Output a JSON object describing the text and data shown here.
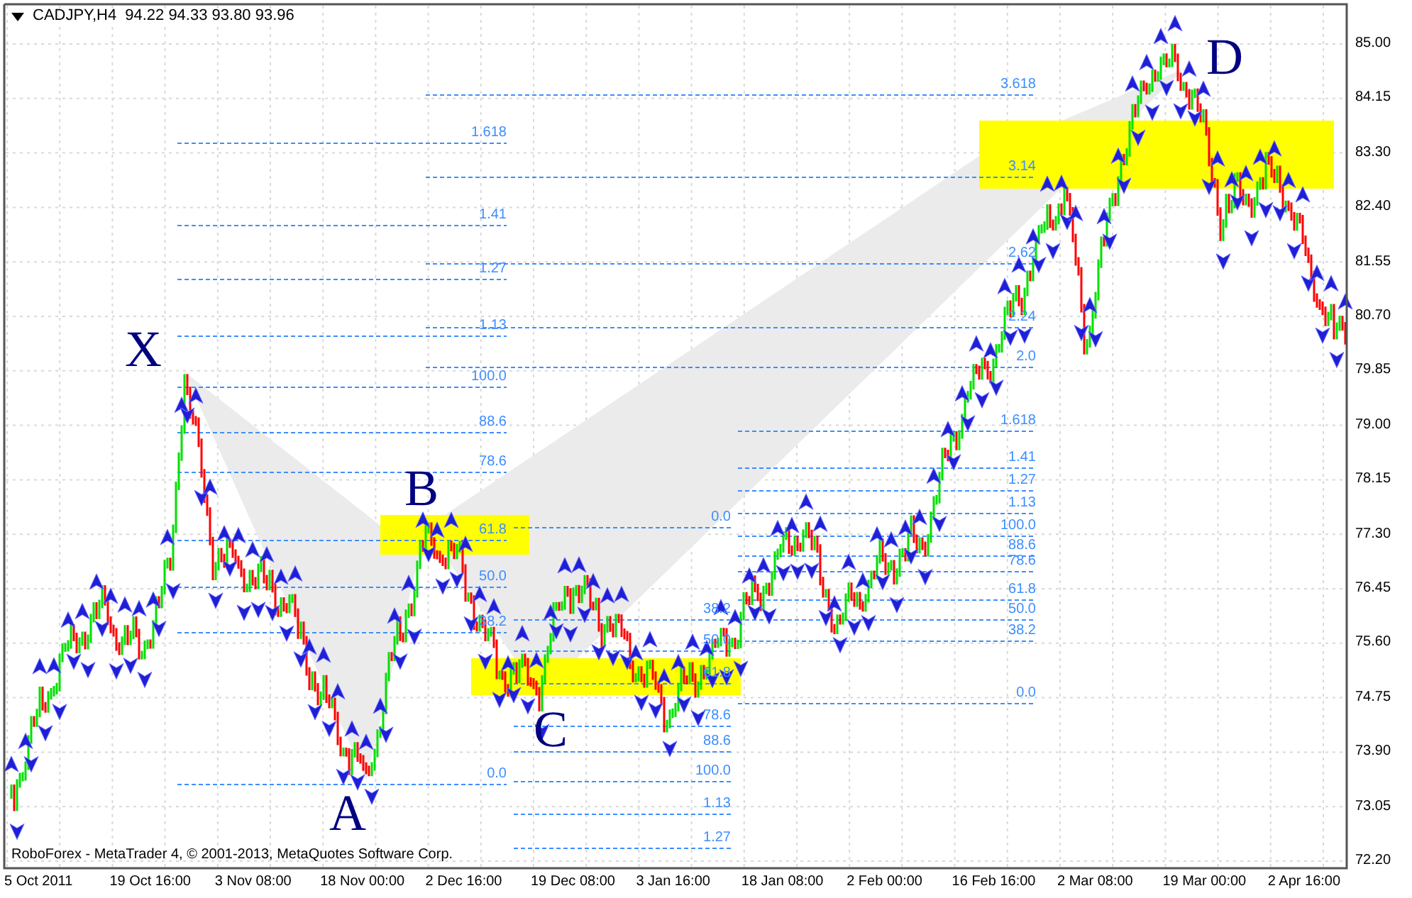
{
  "chart": {
    "symbol": "CADJPY,H4",
    "ohlc": "94.22 94.33 93.80 93.96"
  },
  "price_axis": [
    "85.00",
    "84.15",
    "83.30",
    "82.40",
    "81.55",
    "80.70",
    "79.85",
    "79.00",
    "78.15",
    "77.30",
    "76.45",
    "75.60",
    "74.75",
    "73.90",
    "73.05",
    "72.20"
  ],
  "time_axis": [
    "5 Oct 2011",
    "19 Oct 16:00",
    "3 Nov 08:00",
    "18 Nov 00:00",
    "2 Dec 16:00",
    "19 Dec 08:00",
    "3 Jan 16:00",
    "18 Jan 08:00",
    "2 Feb 00:00",
    "16 Feb 16:00",
    "2 Mar 08:00",
    "19 Mar 00:00",
    "2 Apr 16:00"
  ],
  "fib_sets": [
    {
      "levels": [
        "1.618",
        "1.41",
        "1.27",
        "1.13",
        "100.0",
        "88.6",
        "78.6",
        "61.8",
        "50.0",
        "38.2",
        "0.0"
      ]
    },
    {
      "levels": [
        "3.618",
        "3.14",
        "2.62",
        "2.24",
        "2.0",
        "1.618",
        "1.41",
        "1.27",
        "1.13",
        "100.0",
        "88.6",
        "78.6",
        "61.8",
        "50.0",
        "38.2",
        "0.0"
      ]
    },
    {
      "levels": [
        "0.0",
        "38.2",
        "50.0",
        "61.8",
        "78.6",
        "88.6",
        "100.0",
        "1.13",
        "1.27"
      ]
    }
  ],
  "points": [
    "X",
    "A",
    "B",
    "C",
    "D"
  ],
  "footer": "RoboForex - MetaTrader 4, © 2001-2013, MetaQuotes Software Corp."
}
